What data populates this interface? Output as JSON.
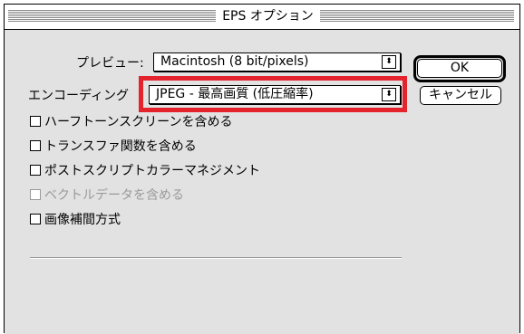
{
  "window": {
    "title": "EPS オプション"
  },
  "preview": {
    "label": "プレビュー:",
    "value": "Macintosh (8 bit/pixels)",
    "arrow": "⬍"
  },
  "encoding": {
    "label": "エンコーディング",
    "value": "JPEG - 最高画質 (低圧縮率)",
    "arrow": "⬍"
  },
  "buttons": {
    "ok": "OK",
    "cancel": "キャンセル"
  },
  "options": [
    {
      "label": "ハーフトーンスクリーンを含める",
      "checked": false,
      "enabled": true
    },
    {
      "label": "トランスファ関数を含める",
      "checked": false,
      "enabled": true
    },
    {
      "label": "ポストスクリプトカラーマネジメント",
      "checked": false,
      "enabled": true
    },
    {
      "label": "ベクトルデータを含める",
      "checked": false,
      "enabled": false
    },
    {
      "label": "画像補間方式",
      "checked": false,
      "enabled": true
    }
  ],
  "colors": {
    "highlight": "#e4232d",
    "dialog_bg": "#e2e2e2"
  }
}
